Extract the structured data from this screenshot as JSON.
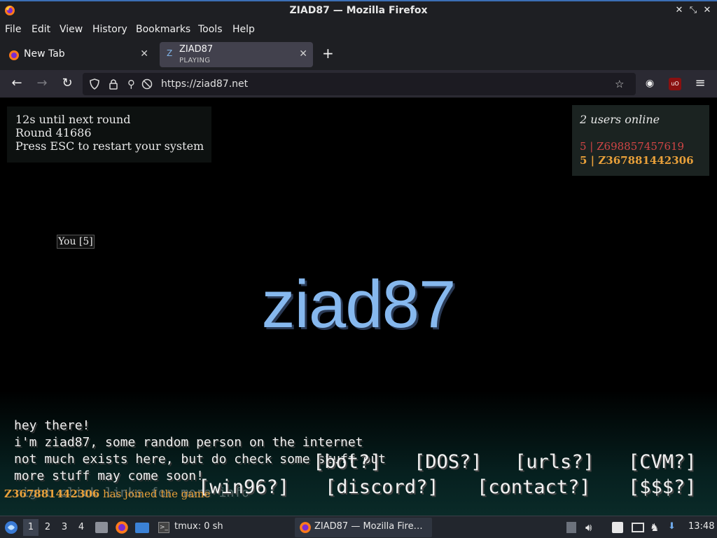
{
  "window": {
    "title": "ZIAD87 — Mozilla Firefox",
    "controls": [
      "minimize",
      "maximize",
      "close"
    ]
  },
  "menu": [
    "File",
    "Edit",
    "View",
    "History",
    "Bookmarks",
    "Tools",
    "Help"
  ],
  "tabs": [
    {
      "label": "New Tab",
      "active": false
    },
    {
      "label": "ZIAD87",
      "sublabel": "PLAYING",
      "icon_char": "Z",
      "active": true
    }
  ],
  "navbar": {
    "url": "https://ziad87.net"
  },
  "page": {
    "round": {
      "countdown": "12s until next round",
      "round_number": "Round 41686",
      "hint": "Press ESC to restart your system"
    },
    "users": {
      "title": "2 users online",
      "list": [
        "5 | Z698857457619",
        "5 | Z367881442306"
      ]
    },
    "you_label": "You [5]",
    "logo": "ziad87",
    "intro": [
      "hey there!",
      "i'm ziad87, some random person on the internet",
      "not much exists here, but do check some stuff out",
      "more stuff may come soon!",
      "right click links for more info"
    ],
    "links_row1": [
      "[bot?]",
      "[DOS?]",
      "[urls?]",
      "[CVM?]"
    ],
    "links_row2": [
      "[win96?]",
      "[discord?]",
      "[contact?]",
      "[$$$?]"
    ],
    "join_message": {
      "name": "Z367881442306",
      "text": " has joined the game"
    }
  },
  "taskbar": {
    "workspaces": [
      "1",
      "2",
      "3",
      "4"
    ],
    "terminal": "tmux: 0 sh",
    "task": "ZIAD87 — Mozilla Fire…",
    "clock": "13:48"
  },
  "colors": {
    "logo": "#86b8ee",
    "user1": "#d04545",
    "user2": "#e8a03a",
    "chrome_bg": "#1e1f23"
  }
}
